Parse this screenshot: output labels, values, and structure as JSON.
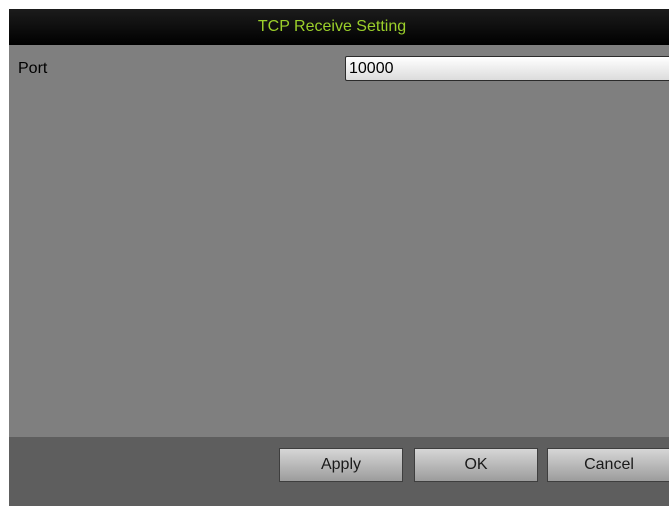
{
  "dialog": {
    "title": "TCP Receive Setting",
    "title_color": "#9bcf2a",
    "background_color": "#7f7f7f"
  },
  "port": {
    "label": "Port",
    "value": "10000"
  },
  "buttons": {
    "apply_label": "Apply",
    "ok_label": "OK",
    "cancel_label": "Cancel"
  }
}
